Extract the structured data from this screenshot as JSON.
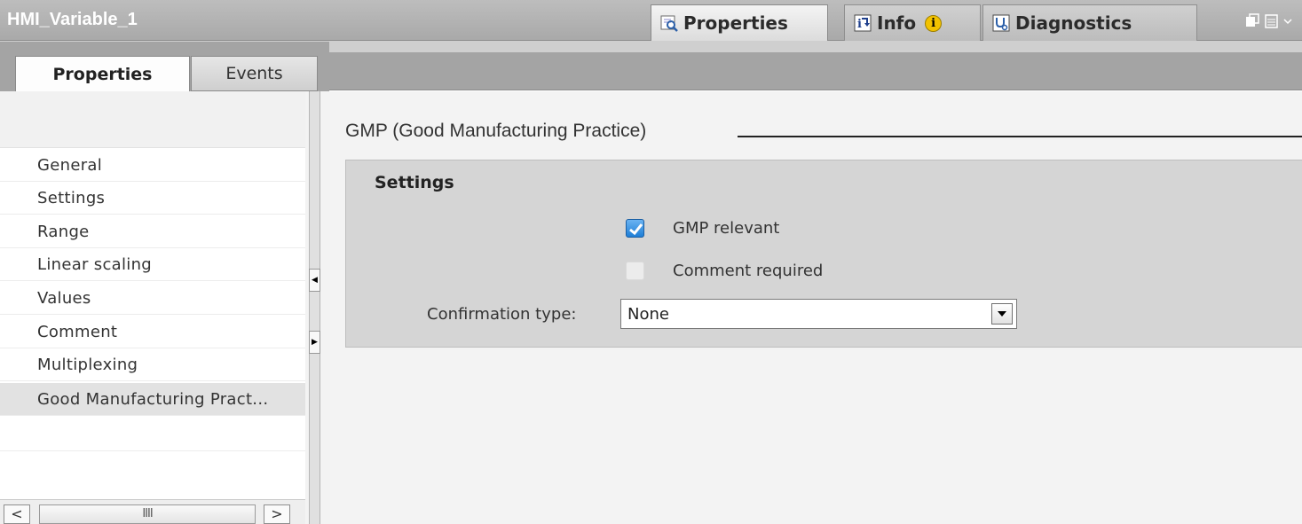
{
  "window": {
    "title": "HMI_Variable_1",
    "tabs": [
      {
        "label": "Properties",
        "icon": "properties-icon",
        "active": true
      },
      {
        "label": "Info",
        "icon": "info-icon",
        "active": false
      },
      {
        "label": "Diagnostics",
        "icon": "diagnostics-icon",
        "active": false
      }
    ],
    "info_badge": "i"
  },
  "subtabs": [
    {
      "label": "Properties",
      "active": true
    },
    {
      "label": "Events",
      "active": false
    }
  ],
  "sidebar": {
    "items": [
      {
        "label": "General"
      },
      {
        "label": "Settings"
      },
      {
        "label": "Range"
      },
      {
        "label": "Linear scaling"
      },
      {
        "label": "Values"
      },
      {
        "label": "Comment"
      },
      {
        "label": "Multiplexing"
      },
      {
        "label": "Good Manufacturing Pract...",
        "selected": true
      }
    ],
    "scroll_thumb": "IIII"
  },
  "main": {
    "section_title": "GMP (Good Manufacturing Practice)",
    "group_title": "Settings",
    "gmp_relevant": {
      "label": "GMP relevant",
      "checked": true
    },
    "comment_required": {
      "label": "Comment required",
      "checked": false
    },
    "confirmation": {
      "label": "Confirmation type:",
      "value": "None"
    }
  },
  "colors": {
    "titlebar": "#b0b0b0",
    "checkbox_checked": "#2a8ae0",
    "panel": "#d5d5d5"
  }
}
